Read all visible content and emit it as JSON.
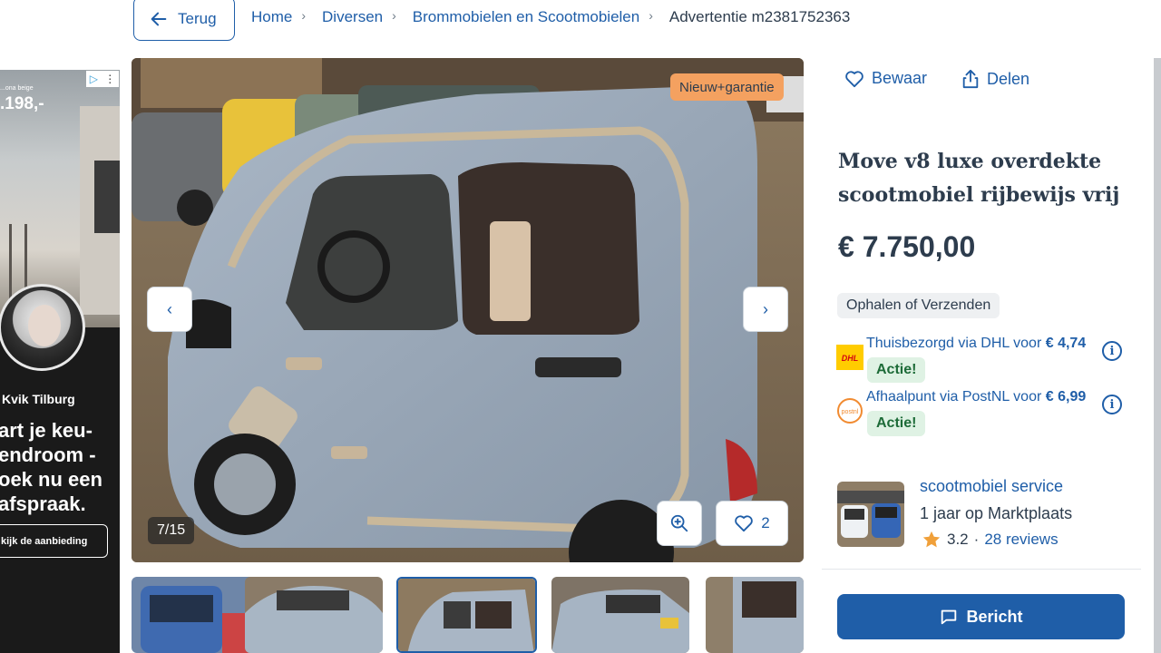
{
  "header": {
    "back_label": "Terug",
    "breadcrumbs": [
      "Home",
      "Diversen",
      "Brommobielen en Scootmobielen"
    ],
    "current": "Advertentie m2381752363"
  },
  "ad": {
    "small_text": "...ona beige",
    "price": ".198,-",
    "brand": "Kvik Tilburg",
    "headline": "art je keu-\nendroom -\noek nu een\nafspraak.",
    "cta": "kijk de aanbieding"
  },
  "gallery": {
    "badge": "Nieuw+garantie",
    "counter": "7/15",
    "favorites": "2",
    "prev_icon": "‹",
    "next_icon": "›"
  },
  "listing": {
    "save_label": "Bewaar",
    "share_label": "Delen",
    "title": "Move v8 luxe overdekte scootmobiel rijbewijs vrij",
    "price": "€ 7.750,00",
    "delivery_tag": "Ophalen of Verzenden",
    "shipping": [
      {
        "text": "Thuisbezorgd via DHL voor ",
        "amount": "€ 4,74",
        "badge": "Actie!",
        "logo": "dhl-logo"
      },
      {
        "text": "Afhaalpunt via PostNL voor ",
        "amount": "€ 6,99",
        "badge": "Actie!",
        "logo": "postnl-logo"
      }
    ]
  },
  "seller": {
    "name": "scootmobiel service",
    "since": "1 jaar op Marktplaats",
    "rating": "3.2",
    "separator": "·",
    "reviews": "28 reviews"
  },
  "message_button": "Bericht",
  "colors": {
    "link": "#1f5ea8",
    "badge_orange": "#f4a160",
    "promo_green": "#dff2e4"
  }
}
